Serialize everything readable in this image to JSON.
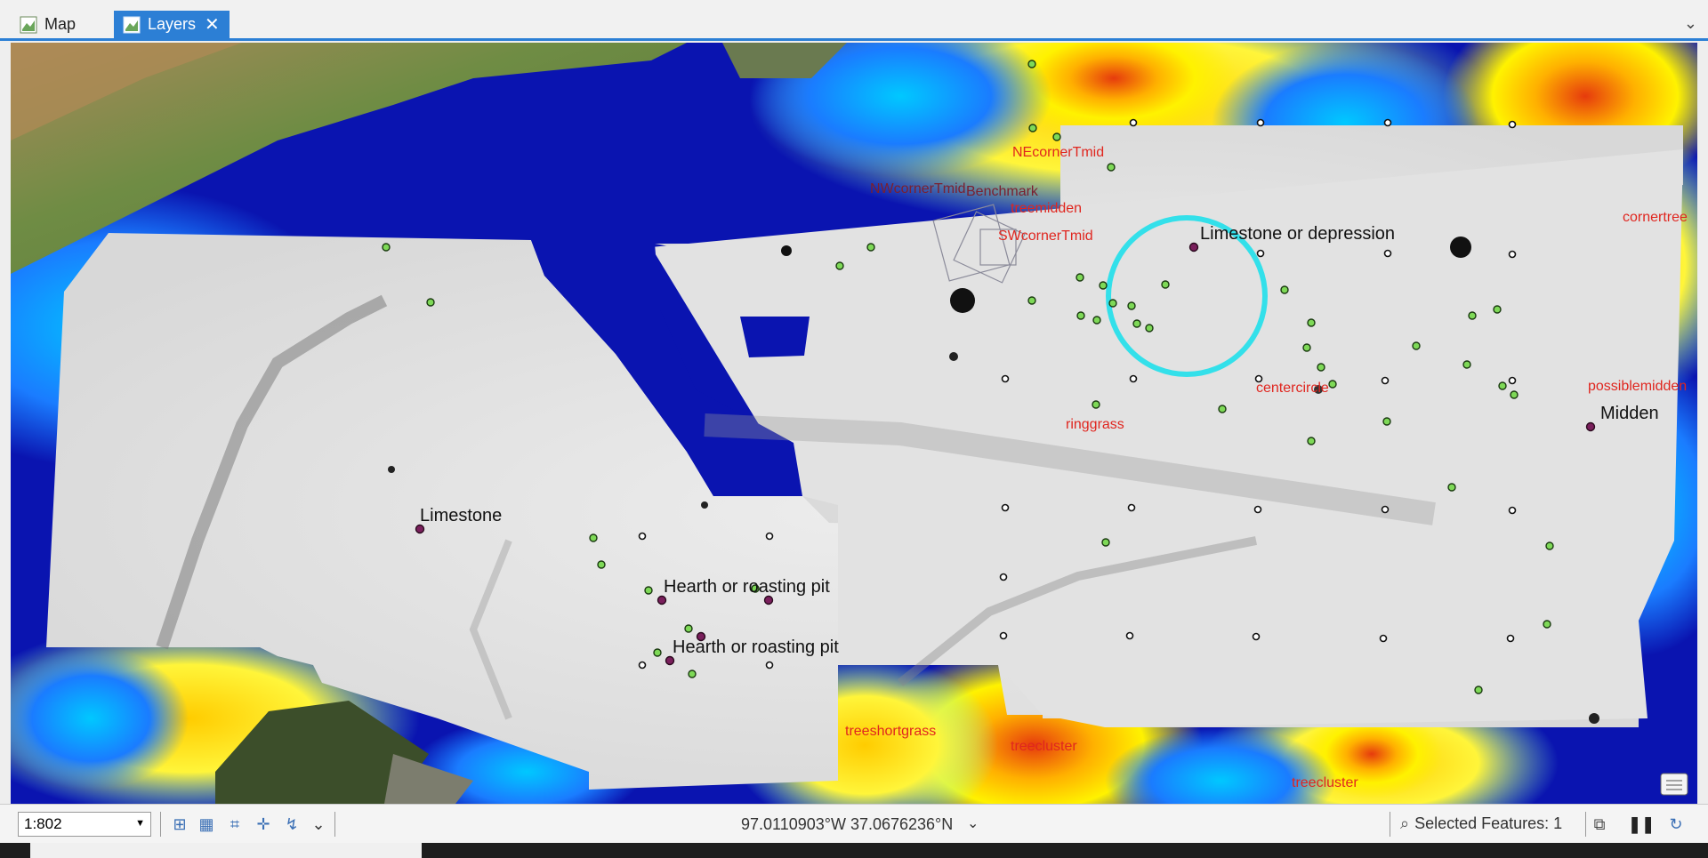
{
  "tabs": [
    {
      "label": "Map",
      "active": false
    },
    {
      "label": "Layers",
      "active": true
    }
  ],
  "status": {
    "scale": "1:802",
    "coordinates": "97.0110903°W 37.0676236°N",
    "selected_features": "Selected Features: 1"
  },
  "icons": {
    "tab_icon": "map-layer-icon",
    "close": "close-icon",
    "collapse": "chevron-down-icon"
  },
  "colors": {
    "accent": "#2c7fd5",
    "label_red": "#e0261f",
    "ring_cyan": "#33e0ea",
    "point_green": "#7ed957",
    "point_purple": "#7a1f5c"
  },
  "map_labels": {
    "black": {
      "limestone_depression": "Limestone or depression",
      "limestone": "Limestone",
      "hearth_1": "Hearth or roasting pit",
      "hearth_2": "Hearth or roasting pit",
      "midden": "Midden"
    },
    "red": {
      "necornertmid": "NEcornerTmid",
      "nwcornertmid": "NWcornerTmid",
      "benchmark": "Benchmark",
      "treemidden": "treemidden",
      "swcornertmid": "SWcornerTmid",
      "cornertree": "cornertree",
      "centercircle": "centercircle",
      "possiblemidden": "possiblemidden",
      "ringgrass": "ringgrass",
      "treeshortgrass": "treeshortgrass",
      "treecluster_1": "treecluster",
      "treecluster_2": "treecluster"
    }
  }
}
